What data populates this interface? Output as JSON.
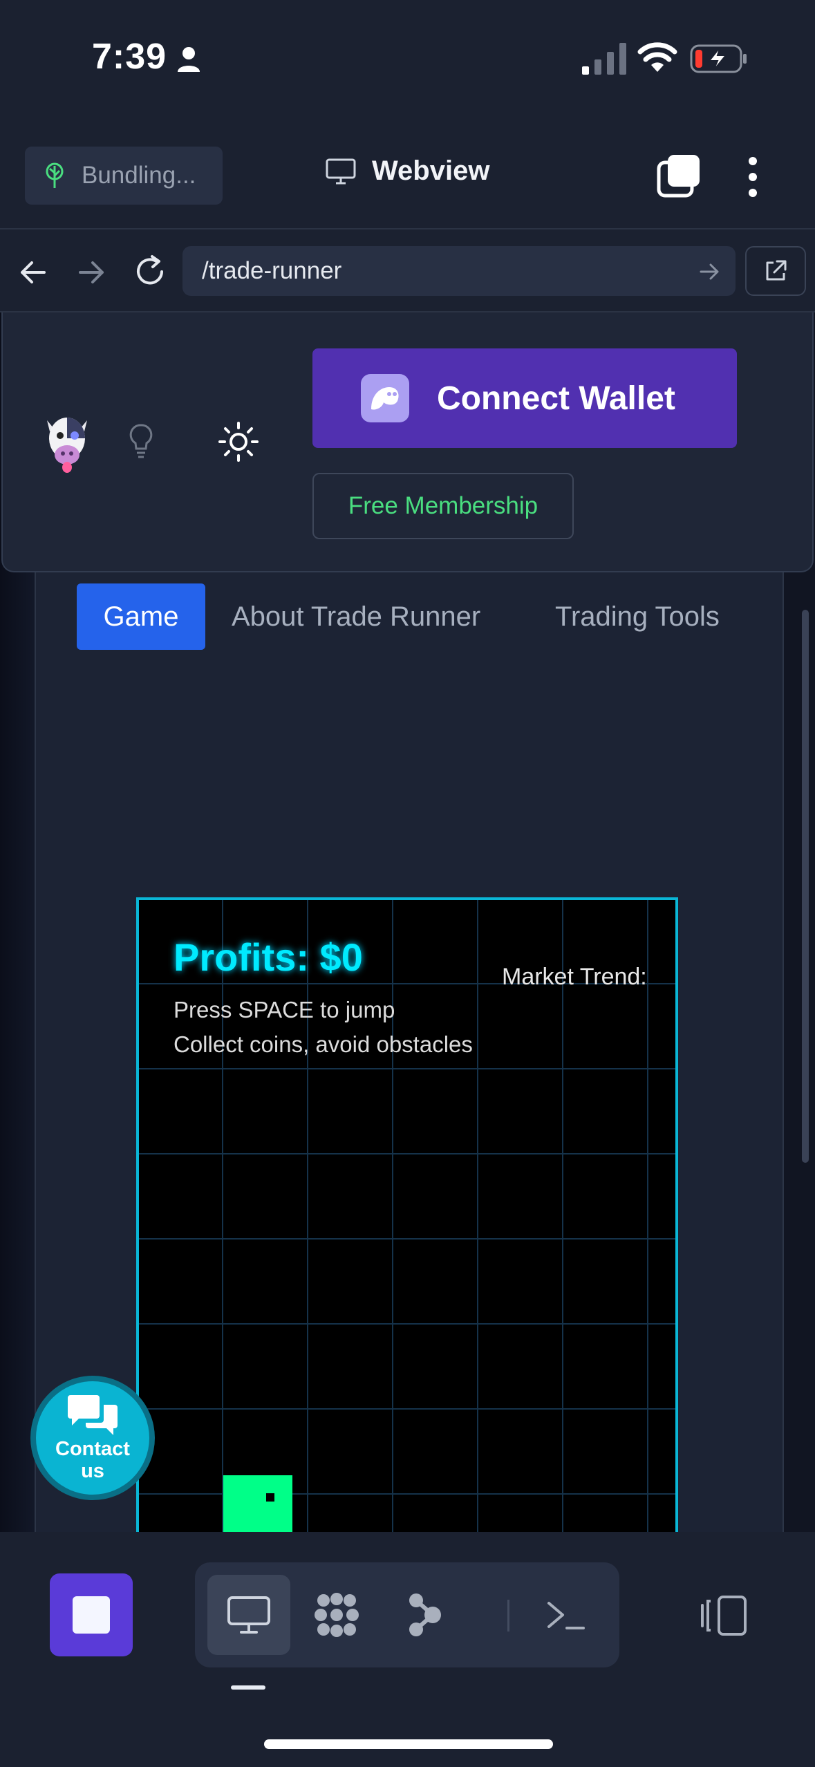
{
  "status_bar": {
    "time": "7:39"
  },
  "toolbar": {
    "bundling_label": "Bundling...",
    "title": "Webview"
  },
  "url_bar": {
    "path": "/trade-runner"
  },
  "site_header": {
    "connect_wallet_label": "Connect Wallet",
    "membership_label": "Free Membership"
  },
  "tabs": [
    {
      "label": "Game",
      "active": true
    },
    {
      "label": "About Trade Runner",
      "active": false
    },
    {
      "label": "Trading Tools",
      "active": false
    }
  ],
  "game": {
    "profits_label": "Profits: $0",
    "market_trend_label": "Market Trend:",
    "hint_jump": "Press SPACE to jump",
    "hint_goal": "Collect coins, avoid obstacles"
  },
  "contact": {
    "label": "Contact us"
  },
  "colors": {
    "accent_blue": "#2563eb",
    "wallet_purple": "#5130b0",
    "membership_green": "#4ade80",
    "game_border": "#0ab6d6",
    "player_green": "#00ff88",
    "stop_purple": "#5a3bd8"
  }
}
